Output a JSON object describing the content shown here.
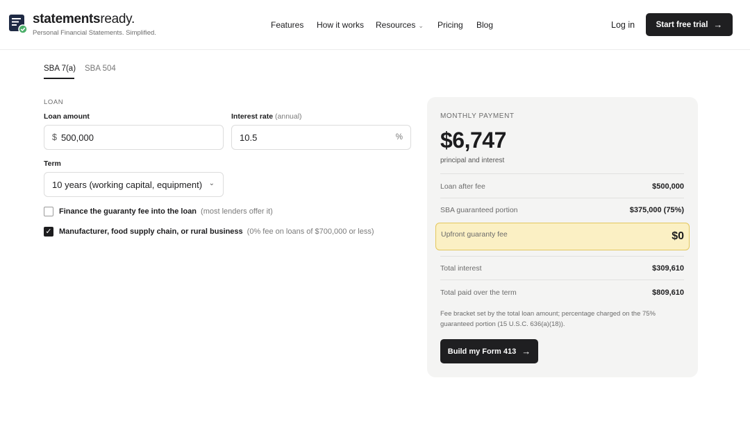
{
  "brand": {
    "name_bold": "statements",
    "name_light": "ready.",
    "tagline": "Personal Financial Statements. Simplified.",
    "logo_icon": "document-check-icon"
  },
  "nav": {
    "items": [
      "Features",
      "How it works",
      "Resources",
      "Pricing",
      "Blog"
    ],
    "login": "Log in",
    "cta": "Start free trial"
  },
  "tabs": [
    {
      "label": "SBA 7(a)",
      "active": true
    },
    {
      "label": "SBA 504",
      "active": false
    }
  ],
  "form": {
    "section": "LOAN",
    "loan_amount": {
      "label": "Loan amount",
      "prefix": "$",
      "value": "500,000"
    },
    "interest_rate": {
      "label": "Interest rate",
      "qualifier": "(annual)",
      "value": "10.5",
      "suffix": "%"
    },
    "term": {
      "label": "Term",
      "value": "10 years (working capital, equipment)"
    },
    "options": [
      {
        "label": "Finance the guaranty fee into the loan",
        "note": "(most lenders offer it)",
        "checked": false
      },
      {
        "label": "Manufacturer, food supply chain, or rural business",
        "note": "(0% fee on loans of $700,000 or less)",
        "checked": true
      }
    ]
  },
  "result": {
    "title": "MONTHLY PAYMENT",
    "amount": "$6,747",
    "subtitle": "principal and interest",
    "rows": [
      {
        "label": "Loan after fee",
        "value": "$500,000"
      },
      {
        "label": "SBA guaranteed portion",
        "value": "$375,000 (75%)"
      },
      {
        "label": "Upfront guaranty fee",
        "value": "$0",
        "highlight": true
      },
      {
        "label": "Total interest",
        "value": "$309,610"
      },
      {
        "label": "Total paid over the term",
        "value": "$809,610"
      }
    ],
    "note": "Fee bracket set by the total loan amount; percentage charged on the 75% guaranteed portion (15 U.S.C. 636(a)(18)).",
    "button": "Build my Form 413"
  },
  "colors": {
    "accent_dark": "#1f1f21",
    "highlight_bg": "#fbf0c4",
    "highlight_border": "#e3c65c",
    "check_green": "#4caf6a"
  }
}
